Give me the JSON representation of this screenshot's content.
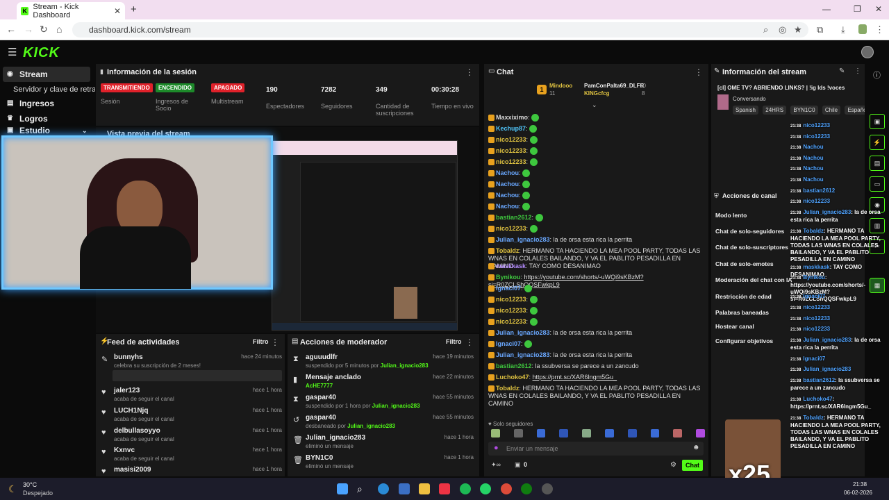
{
  "browser": {
    "tab_title": "Stream - Kick Dashboard",
    "url": "dashboard.kick.com/stream"
  },
  "kick": {
    "logo": "KICK"
  },
  "sidebar": {
    "items": [
      {
        "label": "Stream"
      },
      {
        "label": "Servidor y clave de retransm"
      },
      {
        "label": "Ingresos"
      },
      {
        "label": "Logros"
      },
      {
        "label": "Estudio"
      }
    ]
  },
  "session": {
    "title": "Información de la sesión",
    "stats": [
      {
        "badge": "TRANSMITIENDO",
        "badge_color": "#e0212a",
        "label": "Sesión"
      },
      {
        "badge": "ENCENDIDO",
        "badge_color": "#1d8a2a",
        "label": "Ingresos de Socio"
      },
      {
        "badge": "APAGADO",
        "badge_color": "#e0212a",
        "label": "Multistream"
      },
      {
        "value": "190",
        "label": "Espectadores"
      },
      {
        "value": "7282",
        "label": "Seguidores"
      },
      {
        "value": "349",
        "label": "Cantidad de suscripciones"
      },
      {
        "value": "00:30:28",
        "label": "Tiempo en vivo"
      }
    ]
  },
  "preview": {
    "title": "Vista previa del stream"
  },
  "feed": {
    "title": "Feed de actividades",
    "filter": "Filtro",
    "items": [
      {
        "name": "bunnyhs",
        "desc": "celebra su suscripción de 2 meses!",
        "time": "hace 24 minutos",
        "icon": "sub-icon"
      },
      {
        "name": "jaler123",
        "desc": "acaba de seguir el canal",
        "time": "hace 1 hora",
        "icon": "heart-icon"
      },
      {
        "name": "LUCH1Njq",
        "desc": "acaba de seguir el canal",
        "time": "hace 1 hora",
        "icon": "heart-icon"
      },
      {
        "name": "delbullasoyyo",
        "desc": "acaba de seguir el canal",
        "time": "hace 1 hora",
        "icon": "heart-icon"
      },
      {
        "name": "Kxnvc",
        "desc": "acaba de seguir el canal",
        "time": "hace 1 hora",
        "icon": "heart-icon"
      },
      {
        "name": "masisi2009",
        "desc": "",
        "time": "hace 1 hora",
        "icon": "heart-icon"
      }
    ]
  },
  "modactions": {
    "title": "Acciones de moderador",
    "filter": "Filtro",
    "items": [
      {
        "name": "aguuudlfr",
        "desc": "suspendido por 5 minutos por",
        "by": "Julian_ignacio283",
        "time": "hace 19 minutos"
      },
      {
        "name": "Mensaje anclado",
        "desc": "",
        "by": "AcHE7777",
        "time": "hace 22 minutos"
      },
      {
        "name": "gaspar40",
        "desc": "suspendido por 1 hora por",
        "by": "Julian_ignacio283",
        "time": "hace 55 minutos"
      },
      {
        "name": "gaspar40",
        "desc": "desbaneado por",
        "by": "Julian_ignacio283",
        "time": "hace 55 minutos"
      },
      {
        "name": "Julian_ignacio283",
        "desc": "eliminó un mensaje",
        "by": "",
        "time": "hace 1 hora"
      },
      {
        "name": "BYN1C0",
        "desc": "eliminó un mensaje",
        "by": "",
        "time": "hace 1 hora"
      }
    ]
  },
  "chat": {
    "title": "Chat",
    "top_gifters": [
      {
        "name": "Mindooo",
        "count": "11"
      },
      {
        "name": "PamConPalta69_DLFR",
        "count": "10"
      },
      {
        "name": "KINGcfcg",
        "count": "8"
      }
    ],
    "messages": [
      {
        "user": "Maxxiximo",
        "text": "",
        "color": "#d9d9d9"
      },
      {
        "user": "Kechup87",
        "text": "",
        "color": "#4fc3f7"
      },
      {
        "user": "nico12233",
        "text": "",
        "color": "#e0c341"
      },
      {
        "user": "nico12233",
        "text": "",
        "color": "#e0c341"
      },
      {
        "user": "nico12233",
        "text": "",
        "color": "#e0c341"
      },
      {
        "user": "Nachou",
        "text": "",
        "color": "#6aa8ff"
      },
      {
        "user": "Nachou",
        "text": "",
        "color": "#6aa8ff"
      },
      {
        "user": "Nachou",
        "text": "",
        "color": "#6aa8ff"
      },
      {
        "user": "Nachou",
        "text": "",
        "color": "#6aa8ff"
      },
      {
        "user": "bastian2612",
        "text": "",
        "color": "#3ec73e"
      },
      {
        "user": "nico12233",
        "text": "",
        "color": "#e0c341"
      },
      {
        "user": "Julian_ignacio283",
        "text": "la de orsa esta rica la perrita",
        "color": "#6aa8ff"
      },
      {
        "user": "Tobaldz",
        "text": "HERMANO TA HACIENDO LA MEA POOL PARTY, TODAS LAS WNAS EN COLALES BAILANDO, Y VA EL PABLITO PESADILLA EN CAMINO",
        "color": "#e0c341"
      },
      {
        "user": "maskkask",
        "text": "TAY COMO DESANIMAO",
        "color": "#b48cff"
      },
      {
        "user": "Bynikou",
        "text": "https://youtube.com/shorts/-uWQi9sKBzM?si=R0ZCLShQQSFwkpL9",
        "color": "#3ec73e"
      },
      {
        "user": "Ignaci07",
        "text": "",
        "color": "#6aa8ff"
      },
      {
        "user": "nico12233",
        "text": "",
        "color": "#e0c341"
      },
      {
        "user": "nico12233",
        "text": "",
        "color": "#e0c341"
      },
      {
        "user": "nico12233",
        "text": "",
        "color": "#e0c341"
      },
      {
        "user": "Julian_ignacio283",
        "text": "la de orsa esta rica la perrita",
        "color": "#6aa8ff"
      },
      {
        "user": "Ignaci07",
        "text": "",
        "color": "#6aa8ff"
      },
      {
        "user": "Julian_ignacio283",
        "text": "la de orsa esta rica la perrita",
        "color": "#6aa8ff"
      },
      {
        "user": "bastian2612",
        "text": "la ssubversa se parece a un zancudo",
        "color": "#3ec73e"
      },
      {
        "user": "Luchoko47",
        "text": "https://prnt.sc/XAR6lngm5Gu_",
        "color": "#e0c341"
      },
      {
        "user": "Tobaldz",
        "text": "HERMANO TA HACIENDO LA MEA POOL PARTY, TODAS LAS WNAS EN COLALES BAILANDO, Y VA EL PABLITO PESADILLA EN CAMINO",
        "color": "#e0c341"
      }
    ],
    "followers_only": "Solo seguidores",
    "input_placeholder": "Enviar un mensaje",
    "send_label": "Chat",
    "counter": "0"
  },
  "stream_info": {
    "title": "Información del stream",
    "stream_title": "[cl] OME TV? ABRIENDO LINKS? | !ig lds !voces",
    "category": "Conversando",
    "tags": [
      "Spanish",
      "24HRS",
      "BYN1C0",
      "Chile",
      "Españo"
    ]
  },
  "channel_actions": {
    "title": "Acciones de canal",
    "items": [
      "Modo lento",
      "Chat de solo-seguidores",
      "Chat de solo-suscriptores",
      "Chat de solo-emotes",
      "Moderación del chat con IA",
      "Restricción de edad",
      "Palabras baneadas",
      "Hostear canal",
      "Configurar objetivos"
    ]
  },
  "overlay_chat": [
    {
      "time": "21:38",
      "user": "nico12233",
      "text": ""
    },
    {
      "time": "21:38",
      "user": "nico12233",
      "text": ""
    },
    {
      "time": "21:38",
      "user": "Nachou",
      "text": ""
    },
    {
      "time": "21:38",
      "user": "Nachou",
      "text": ""
    },
    {
      "time": "21:38",
      "user": "Nachou",
      "text": ""
    },
    {
      "time": "21:38",
      "user": "Nachou",
      "text": ""
    },
    {
      "time": "21:38",
      "user": "bastian2612",
      "text": ""
    },
    {
      "time": "21:38",
      "user": "nico12233",
      "text": ""
    },
    {
      "time": "21:38",
      "user": "Julian_ignacio283",
      "text": ": la de orsa esta rica la perrita"
    },
    {
      "time": "21:38",
      "user": "Tobaldz",
      "text": ": HERMANO TA HACIENDO LA MEA POOL PARTY, TODAS LAS WNAS EN COLALES BAILANDO, Y VA EL PABLITO PESADILLA EN CAMINO"
    },
    {
      "time": "21:38",
      "user": "maskkask",
      "text": ": TAY COMO DESANIMAO"
    },
    {
      "time": "21:38",
      "user": "Bynikou",
      "text": ": https://youtube.com/shorts/-uWQi9sKBzM?si=R0ZCLShQQSFwkpL9"
    },
    {
      "time": "21:38",
      "user": "Ignaci07",
      "text": ""
    },
    {
      "time": "21:38",
      "user": "nico12233",
      "text": ""
    },
    {
      "time": "21:38",
      "user": "nico12233",
      "text": ""
    },
    {
      "time": "21:38",
      "user": "nico12233",
      "text": ""
    },
    {
      "time": "21:38",
      "user": "Julian_ignacio283",
      "text": ": la de orsa esta rica la perrita"
    },
    {
      "time": "21:38",
      "user": "Ignaci07",
      "text": ""
    },
    {
      "time": "21:38",
      "user": "Julian_ignacio283",
      "text": ""
    },
    {
      "time": "21:38",
      "user": "bastian2612",
      "text": ": la ssubversa se parece a un zancudo"
    },
    {
      "time": "21:38",
      "user": "Luchoko47",
      "text": ": https://prnt.sc/XAR6lngm5Gu_"
    },
    {
      "time": "21:38",
      "user": "Tobaldz",
      "text": ": HERMANO TA HACIENDO LA MEA POOL PARTY, TODAS LAS WNAS EN COLALES BAILANDO, Y VA EL PABLITO PESADILLA EN CAMINO"
    }
  ],
  "overlay_x25": "x25",
  "taskbar": {
    "weather_temp": "30°C",
    "weather_desc": "Despejado",
    "time": "21:38",
    "date": "06-02-2026"
  }
}
